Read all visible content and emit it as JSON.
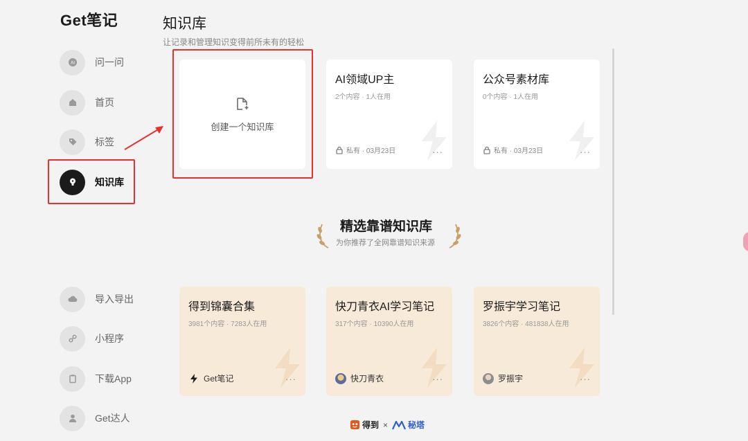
{
  "app": {
    "logo": "Get笔记"
  },
  "sidebar": {
    "items": [
      {
        "label": "问一问",
        "icon": "ai-chat-icon"
      },
      {
        "label": "首页",
        "icon": "home-icon"
      },
      {
        "label": "标签",
        "icon": "tag-icon"
      },
      {
        "label": "知识库",
        "icon": "lightbulb-icon",
        "active": true
      },
      {
        "label": "导入导出",
        "icon": "cloud-icon"
      },
      {
        "label": "小程序",
        "icon": "link-icon"
      },
      {
        "label": "下载App",
        "icon": "clipboard-icon"
      },
      {
        "label": "Get达人",
        "icon": "person-icon"
      }
    ]
  },
  "main": {
    "title": "知识库",
    "subtitle": "让记录和管理知识变得前所未有的轻松",
    "create_label": "创建一个知识库",
    "my_cards": [
      {
        "title": "AI领域UP主",
        "meta": "2个内容 · 1人在用",
        "privacy": "私有 · 03月23日"
      },
      {
        "title": "公众号素材库",
        "meta": "0个内容 · 1人在用",
        "privacy": "私有 · 03月23日"
      }
    ],
    "featured": {
      "title": "精选靠谱知识库",
      "subtitle": "为你推荐了全网靠谱知识来源"
    },
    "featured_cards": [
      {
        "title": "得到锦囊合集",
        "meta": "3981个内容 · 7283人在用",
        "owner": "Get笔记"
      },
      {
        "title": "快刀青衣AI学习笔记",
        "meta": "317个内容 · 10390人在用",
        "owner": "快刀青衣"
      },
      {
        "title": "罗振宇学习笔记",
        "meta": "3826个内容 · 481838人在用",
        "owner": "罗振宇"
      }
    ],
    "more_label": "···"
  },
  "footer": {
    "brand_left": "得到",
    "separator": "×",
    "brand_right": "秘塔"
  },
  "colors": {
    "highlight": "#e8312f",
    "accent_dark": "#1b1b1b",
    "featured_bg": "#f8ead9",
    "laurel": "#c9a06a"
  }
}
